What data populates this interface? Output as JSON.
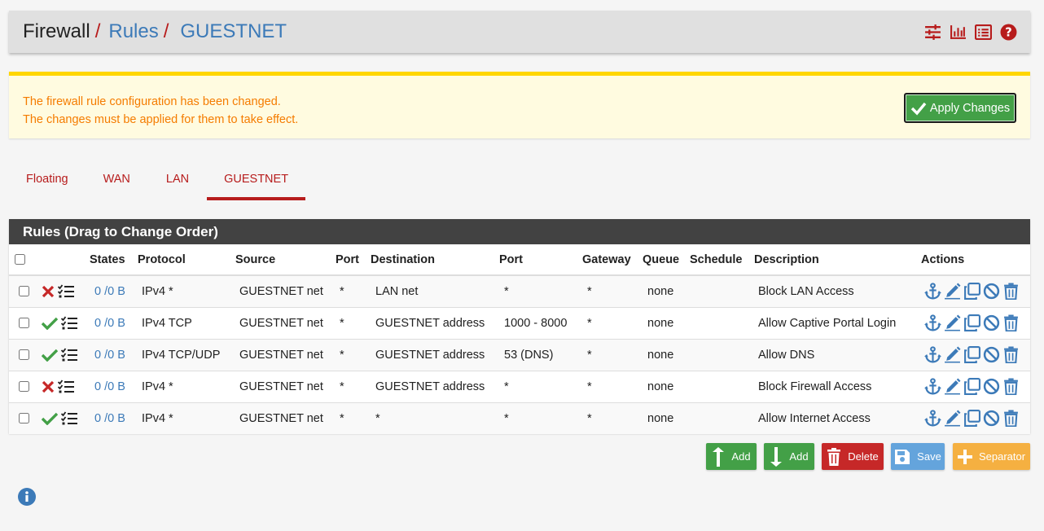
{
  "breadcrumb": {
    "root": "Firewall",
    "sep": "/",
    "rules": "Rules",
    "current": "GUESTNET"
  },
  "header_icons": [
    "sliders-icon",
    "bar-chart-icon",
    "list-icon",
    "help-icon"
  ],
  "alert": {
    "line1": "The firewall rule configuration has been changed.",
    "line2": "The changes must be applied for them to take effect.",
    "apply_label": "Apply Changes"
  },
  "tabs": [
    {
      "label": "Floating",
      "active": false
    },
    {
      "label": "WAN",
      "active": false
    },
    {
      "label": "LAN",
      "active": false
    },
    {
      "label": "GUESTNET",
      "active": true
    }
  ],
  "panel_title": "Rules (Drag to Change Order)",
  "columns": [
    "",
    "",
    "States",
    "Protocol",
    "Source",
    "Port",
    "Destination",
    "Port",
    "Gateway",
    "Queue",
    "Schedule",
    "Description",
    "Actions"
  ],
  "rows": [
    {
      "action": "block",
      "states": "0 /0 B",
      "protocol": "IPv4 *",
      "source": "GUESTNET net",
      "sport": "*",
      "destination": "LAN net",
      "dport": "*",
      "gateway": "*",
      "queue": "none",
      "schedule": "",
      "description": "Block LAN Access"
    },
    {
      "action": "pass",
      "states": "0 /0 B",
      "protocol": "IPv4 TCP",
      "source": "GUESTNET net",
      "sport": "*",
      "destination": "GUESTNET address",
      "dport": "1000 - 8000",
      "gateway": "*",
      "queue": "none",
      "schedule": "",
      "description": "Allow Captive Portal Login"
    },
    {
      "action": "pass",
      "states": "0 /0 B",
      "protocol": "IPv4 TCP/UDP",
      "source": "GUESTNET net",
      "sport": "*",
      "destination": "GUESTNET address",
      "dport": "53 (DNS)",
      "gateway": "*",
      "queue": "none",
      "schedule": "",
      "description": "Allow DNS"
    },
    {
      "action": "block",
      "states": "0 /0 B",
      "protocol": "IPv4 *",
      "source": "GUESTNET net",
      "sport": "*",
      "destination": "GUESTNET address",
      "dport": "*",
      "gateway": "*",
      "queue": "none",
      "schedule": "",
      "description": "Block Firewall Access"
    },
    {
      "action": "pass",
      "states": "0 /0 B",
      "protocol": "IPv4 *",
      "source": "GUESTNET net",
      "sport": "*",
      "destination": "*",
      "dport": "*",
      "gateway": "*",
      "queue": "none",
      "schedule": "",
      "description": "Allow Internet Access"
    }
  ],
  "buttons": {
    "add_top": "Add",
    "add_bottom": "Add",
    "delete": "Delete",
    "save": "Save",
    "separator": "Separator"
  },
  "colors": {
    "brand_red": "#b71c1c",
    "link_blue": "#3c7ab8",
    "pass_green": "#43a047",
    "block_red": "#c62828",
    "alert_orange": "#f57c00"
  }
}
